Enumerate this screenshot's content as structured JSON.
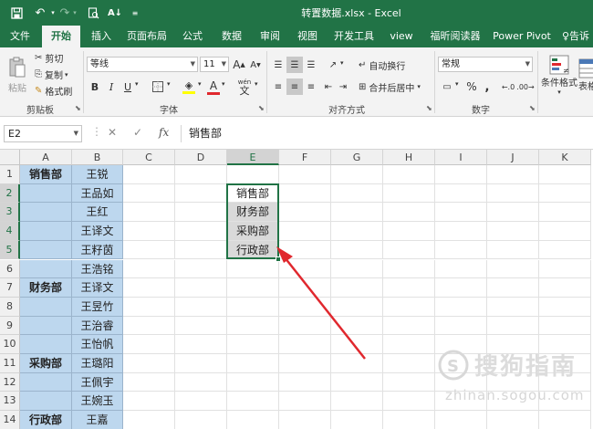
{
  "title": "转置数据.xlsx - Excel",
  "tabs": [
    "文件",
    "开始",
    "插入",
    "页面布局",
    "公式",
    "数据",
    "审阅",
    "视图",
    "开发工具",
    "view",
    "福昕阅读器",
    "Power Pivot",
    "告诉"
  ],
  "active_tab": "开始",
  "clipboard": {
    "paste": "粘贴",
    "cut": "剪切",
    "copy": "复制",
    "format_painter": "格式刷",
    "group": "剪贴板"
  },
  "font": {
    "name": "等线",
    "size": "11",
    "grow": "A",
    "shrink": "A",
    "bold": "B",
    "italic": "I",
    "underline": "U",
    "wen": "wén",
    "group": "字体"
  },
  "alignment": {
    "wrap": "自动换行",
    "merge": "合并后居中",
    "group": "对齐方式"
  },
  "number": {
    "format": "常规",
    "percent": "%",
    "comma": ",",
    "group": "数字"
  },
  "styles": {
    "conditional": "条件格式",
    "table": "表格"
  },
  "formula": {
    "namebox": "E2",
    "fx": "fx",
    "value": "销售部"
  },
  "columns": [
    "A",
    "B",
    "C",
    "D",
    "E",
    "F",
    "G",
    "H",
    "I",
    "J",
    "K"
  ],
  "selected_column": "E",
  "rows": [
    "1",
    "2",
    "3",
    "4",
    "5",
    "6",
    "7",
    "8",
    "9",
    "10",
    "11",
    "12",
    "13",
    "14"
  ],
  "col_a": [
    "销售部",
    "",
    "",
    "",
    "",
    "",
    "财务部",
    "",
    "",
    "",
    "采购部",
    "",
    "",
    "行政部"
  ],
  "col_b": [
    "王锐",
    "王品如",
    "王红",
    "王译文",
    "王籽茵",
    "王浩铭",
    "王译文",
    "王昱竹",
    "王治睿",
    "王怡帆",
    "王璐阳",
    "王佩宇",
    "王婉玉",
    "王嘉"
  ],
  "col_e": [
    "",
    "销售部",
    "财务部",
    "采购部",
    "行政部",
    "",
    "",
    "",
    "",
    "",
    "",
    "",
    "",
    ""
  ],
  "watermark": {
    "brand": "搜狗指南",
    "url": "zhinan.sogou.com"
  },
  "colors": {
    "excel_green": "#217346",
    "blue_fill": "#bdd7ee",
    "arrow": "#e0282e"
  }
}
